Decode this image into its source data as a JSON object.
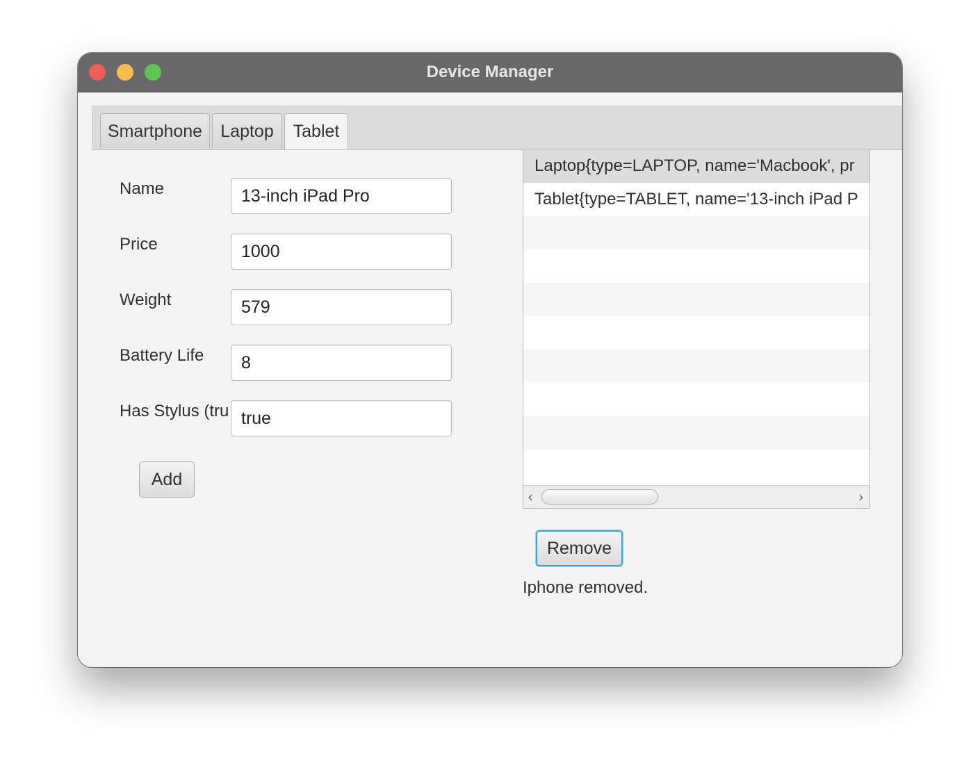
{
  "window": {
    "title": "Device Manager"
  },
  "tabs": [
    {
      "label": "Smartphone",
      "active": false
    },
    {
      "label": "Laptop",
      "active": false
    },
    {
      "label": "Tablet",
      "active": true
    }
  ],
  "form": {
    "fields": [
      {
        "label": "Name",
        "value": "13-inch iPad Pro"
      },
      {
        "label": "Price",
        "value": "1000"
      },
      {
        "label": "Weight",
        "value": "579"
      },
      {
        "label": "Battery Life",
        "value": "8"
      },
      {
        "label": "Has Stylus (tru",
        "value": "true"
      }
    ],
    "add_label": "Add"
  },
  "device_list": {
    "items": [
      {
        "text": "Laptop{type=LAPTOP, name='Macbook', pr",
        "selected": true
      },
      {
        "text": "Tablet{type=TABLET, name='13-inch iPad P",
        "selected": false
      }
    ]
  },
  "remove_label": "Remove",
  "status_message": "Iphone removed.",
  "colors": {
    "titlebar": "#686868",
    "close": "#ee5f57",
    "minimize": "#f5bd4f",
    "maximize": "#60c453",
    "focus_ring": "#3fa0db",
    "selected_row": "#dcdcdc"
  }
}
